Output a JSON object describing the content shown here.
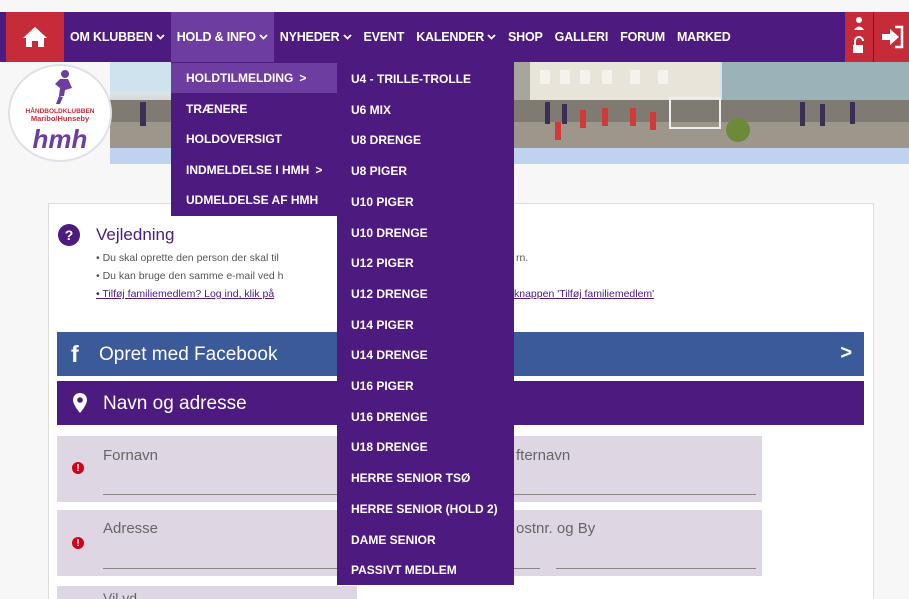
{
  "nav": {
    "items": [
      {
        "label": "OM KLUBBEN",
        "chevron": true
      },
      {
        "label": "HOLD & INFO",
        "chevron": true,
        "active": true
      },
      {
        "label": "NYHEDER",
        "chevron": true
      },
      {
        "label": "EVENT",
        "chevron": false
      },
      {
        "label": "KALENDER",
        "chevron": true
      },
      {
        "label": "SHOP",
        "chevron": false
      },
      {
        "label": "GALLERI",
        "chevron": false
      },
      {
        "label": "FORUM",
        "chevron": false
      },
      {
        "label": "MARKED",
        "chevron": false
      }
    ]
  },
  "logo": {
    "line1": "HÅNDBOLDKLUBBEN",
    "line2": "Maribo/Hunseby",
    "mark": "hmh"
  },
  "submenu": {
    "items": [
      {
        "label": "HOLDTILMELDING",
        "arrow": ">"
      },
      {
        "label": "TRÆNERE"
      },
      {
        "label": "HOLDOVERSIGT"
      },
      {
        "label": "INDMELDELSE I HMH",
        "arrow": ">"
      },
      {
        "label": "UDMELDELSE AF HMH"
      }
    ]
  },
  "teams": {
    "items": [
      "U4 - TRILLE-TROLLE",
      "U6 MIX",
      "U8 DRENGE",
      "U8 PIGER",
      "U10 PIGER",
      "U10 DRENGE",
      "U12 PIGER",
      "U12 DRENGE",
      "U14 PIGER",
      "U14 DRENGE",
      "U16 PIGER",
      "U16 DRENGE",
      "U18 DRENGE",
      "HERRE SENIOR TSØ",
      "HERRE SENIOR (HOLD 2)",
      "DAME SENIOR",
      "PASSIVT MEDLEM"
    ]
  },
  "help": {
    "title": "Vejledning",
    "line1a": "• Du skal oprette den person der skal til",
    "line1b": "rn.",
    "line2": "• Du kan bruge den samme e-mail ved h",
    "line3a": "• Tilføj familiemedlem? Log ind, klik på",
    "line3b": "knappen 'Tilføj familiemedlem'"
  },
  "facebook": {
    "label": "Opret med Facebook",
    "arrow": ">"
  },
  "address_section": {
    "label": "Navn og adresse"
  },
  "fields": {
    "fornavn": "Fornavn",
    "efternavn": "fternavn",
    "adresse": "Adresse",
    "postnr": "ostnr. og By",
    "partial": "Vil vd"
  },
  "colors": {
    "primary": "#4d1a80",
    "accent": "#c62b3a",
    "facebook": "#3b5a9a"
  }
}
